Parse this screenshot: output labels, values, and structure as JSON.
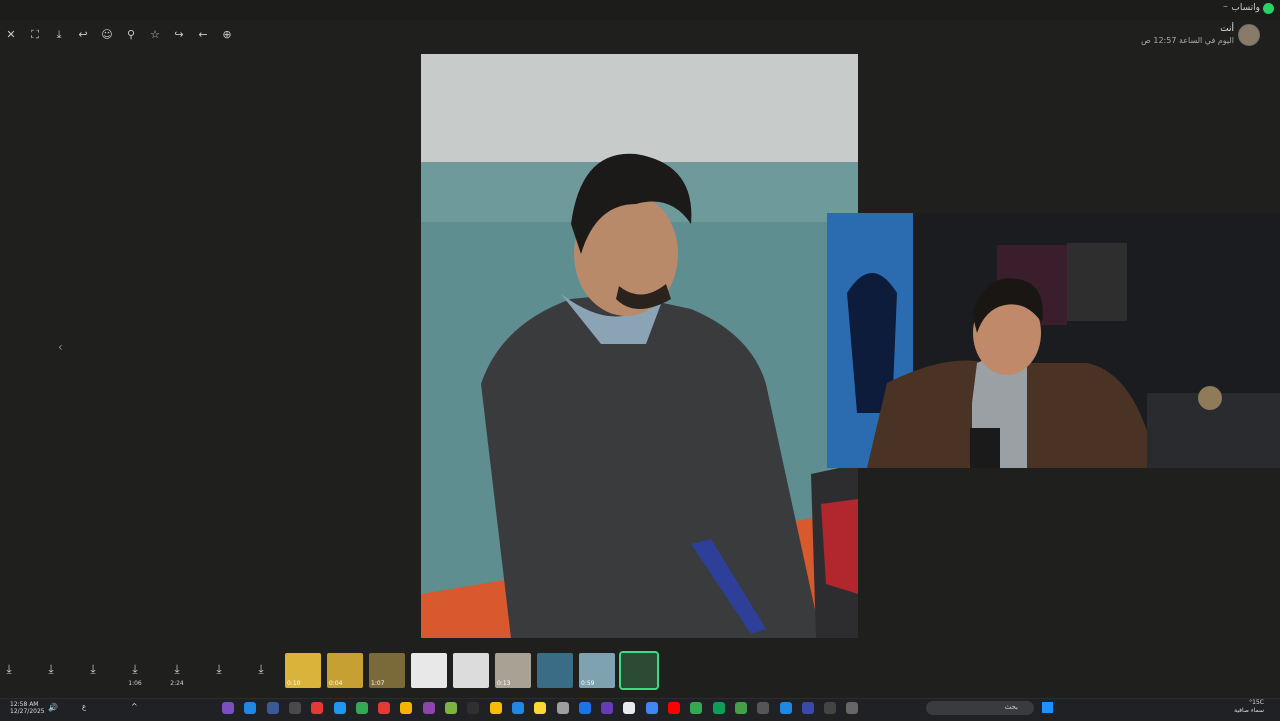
{
  "window": {
    "app_name": "واتساب",
    "minimize": "–"
  },
  "toolbar": {
    "items": [
      {
        "name": "close-icon",
        "glyph": "✕"
      },
      {
        "name": "fit-screen-icon",
        "glyph": "⛶"
      },
      {
        "name": "download-icon",
        "glyph": "⤓"
      },
      {
        "name": "reply-icon",
        "glyph": "↩"
      },
      {
        "name": "emoji-icon",
        "glyph": "☺"
      },
      {
        "name": "pin-icon",
        "glyph": "⚲"
      },
      {
        "name": "star-icon",
        "glyph": "☆"
      },
      {
        "name": "forward-icon",
        "glyph": "↪"
      },
      {
        "name": "back-icon",
        "glyph": "←"
      },
      {
        "name": "zoom-in-icon",
        "glyph": "⊕"
      }
    ]
  },
  "sender": {
    "name": "أنت",
    "time": "اليوم في الساعة 12:57 ص"
  },
  "nav": {
    "prev": "‹"
  },
  "strip": {
    "downloads": [
      {
        "dur": ""
      },
      {
        "dur": ""
      },
      {
        "dur": ""
      },
      {
        "dur": "1:06"
      },
      {
        "dur": "2:24"
      },
      {
        "dur": ""
      },
      {
        "dur": ""
      }
    ],
    "thumbs": [
      {
        "dur": "0:10",
        "color": "#d9b33a"
      },
      {
        "dur": "0:04",
        "color": "#c7a033"
      },
      {
        "dur": "1:07",
        "color": "#7a6a3a"
      },
      {
        "dur": "",
        "color": "#e8e8e8"
      },
      {
        "dur": "",
        "color": "#dcdcdc"
      },
      {
        "dur": "0:13",
        "color": "#a9a294"
      },
      {
        "dur": "",
        "color": "#3b6c86"
      },
      {
        "dur": "0:59",
        "color": "#7ea2b0"
      },
      {
        "dur": "",
        "color": "#2b4b35"
      }
    ]
  },
  "taskbar": {
    "time": "12:58 AM",
    "date": "12/27/2025",
    "lang": "ع",
    "search_placeholder": "بحث",
    "weather_temp": "°15C",
    "weather_desc": "سماء صافية"
  },
  "colors": {
    "accent": "#25d366",
    "selected_thumb_border": "#3ddc84"
  }
}
